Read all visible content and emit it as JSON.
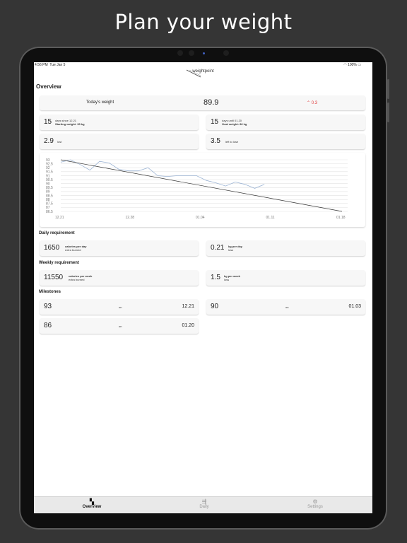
{
  "headline": "Plan your weight",
  "status": {
    "time": "4:56 PM",
    "date": "Tue Jan 5",
    "battery": "100%"
  },
  "app": {
    "logo_text": "weightpoint"
  },
  "overview_title": "Overview",
  "today": {
    "label": "Today's weight",
    "value": "89.9",
    "delta": "0.3",
    "delta_color": "#e03a3a"
  },
  "stats": {
    "since": {
      "num": "15",
      "line1": "days since 12.21",
      "line2": "Starting weight: 93 kg"
    },
    "until": {
      "num": "15",
      "line1": "days until 01.20",
      "line2": "Goal weight: 86 kg"
    },
    "lost": {
      "num": "2.9",
      "label": "lost"
    },
    "left": {
      "num": "3.5",
      "label": "left to lose"
    }
  },
  "chart_data": {
    "type": "line",
    "x_ticks": [
      "12.21",
      "12.28",
      "01.04",
      "01.11",
      "01.18"
    ],
    "y_ticks": [
      "93",
      "92.5",
      "92",
      "91.5",
      "91",
      "90.5",
      "90",
      "89.5",
      "89",
      "88.5",
      "88",
      "87.5",
      "87",
      "86.5"
    ],
    "ylim": [
      86.5,
      93
    ],
    "xlim": [
      0,
      29
    ],
    "grid": true,
    "series": [
      {
        "values": [
          [
            0,
            92.7
          ],
          [
            1,
            93.0
          ],
          [
            2,
            92.4
          ],
          [
            3,
            91.7
          ],
          [
            4,
            92.8
          ],
          [
            5,
            92.6
          ],
          [
            6,
            91.8
          ],
          [
            7,
            91.6
          ],
          [
            8,
            91.6
          ],
          [
            9,
            92.0
          ],
          [
            10,
            91.0
          ],
          [
            11,
            90.9
          ],
          [
            12,
            91.0
          ],
          [
            14,
            91.0
          ],
          [
            15,
            90.4
          ],
          [
            16,
            90.1
          ],
          [
            17,
            89.7
          ],
          [
            18,
            90.2
          ],
          [
            19,
            89.9
          ],
          [
            20,
            89.4
          ],
          [
            21,
            89.9
          ]
        ],
        "color": "#9cb4d4"
      },
      {
        "values": [
          [
            0,
            93.0
          ],
          [
            29,
            86.5
          ]
        ],
        "color": "#333333"
      }
    ]
  },
  "daily": {
    "title": "Daily requirement",
    "calories": {
      "num": "1650",
      "line1": "calories per day",
      "line2": "extra burned"
    },
    "kg": {
      "num": "0.21",
      "line1": "kg per day",
      "line2": "loss"
    }
  },
  "weekly": {
    "title": "Weekly requirement",
    "calories": {
      "num": "11550",
      "line1": "calories per week",
      "line2": "extra burned"
    },
    "kg": {
      "num": "1.5",
      "line1": "kg per week",
      "line2": "loss"
    }
  },
  "milestones": {
    "title": "Milestones",
    "items": [
      {
        "weight": "93",
        "on": "on",
        "date": "12.21"
      },
      {
        "weight": "90",
        "on": "on",
        "date": "01.03"
      },
      {
        "weight": "86",
        "on": "on",
        "date": "01.20"
      }
    ]
  },
  "tabs": [
    {
      "label": "Overview",
      "icon": "grid-icon"
    },
    {
      "label": "Daily",
      "icon": "sliders-icon"
    },
    {
      "label": "Settings",
      "icon": "gear-icon"
    }
  ]
}
